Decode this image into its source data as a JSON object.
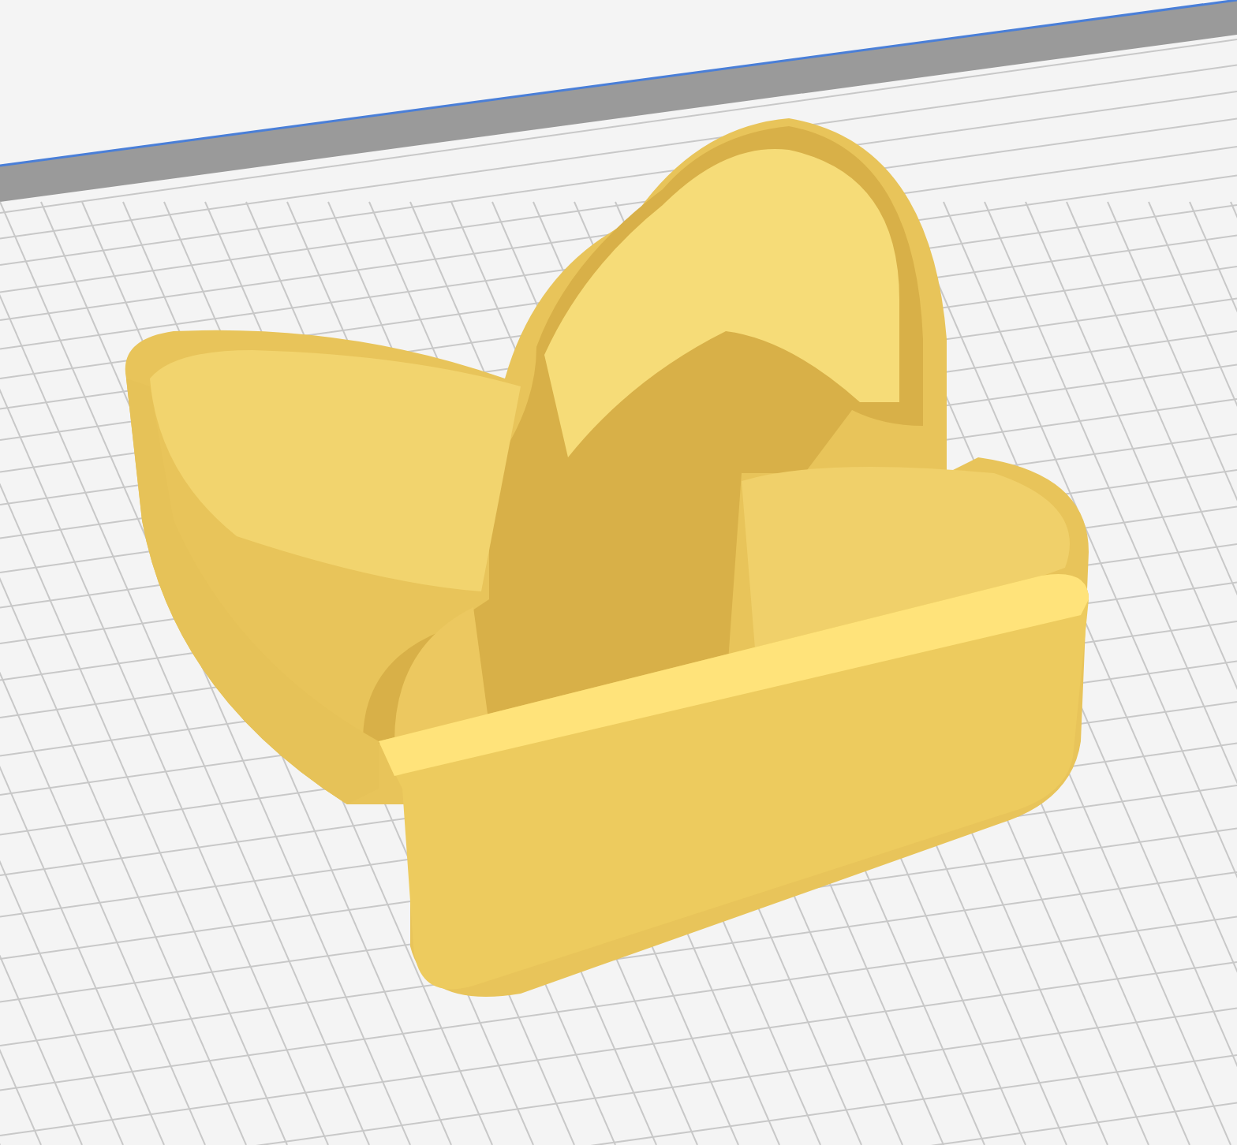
{
  "viewport": {
    "kind": "build-plate"
  }
}
